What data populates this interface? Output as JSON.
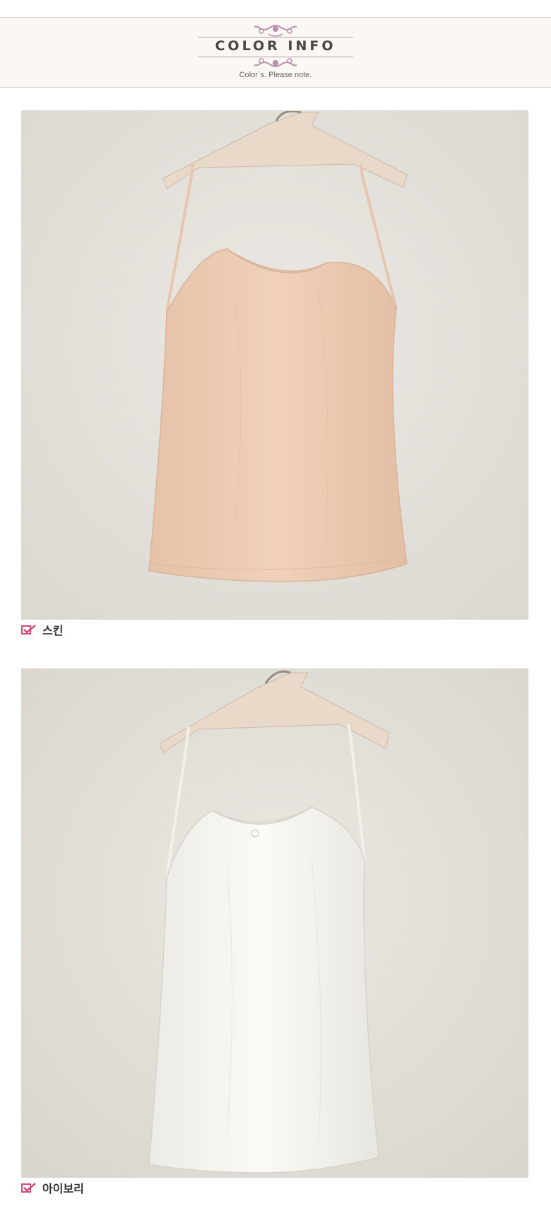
{
  "header": {
    "title": "COLOR INFO",
    "subtitle": "Color`s. Please note."
  },
  "colors": {
    "accent": "#d04a7a",
    "ornament": "#b98fae",
    "band": "#fbf8f4",
    "wall": "#e6e2dc",
    "skin_garment": "#edcbb3",
    "ivory_garment": "#f7f5f0",
    "hanger": "#e8d9c8"
  },
  "products": [
    {
      "label": "스킨",
      "icon": "check-icon"
    },
    {
      "label": "아이보리",
      "icon": "check-icon"
    }
  ]
}
